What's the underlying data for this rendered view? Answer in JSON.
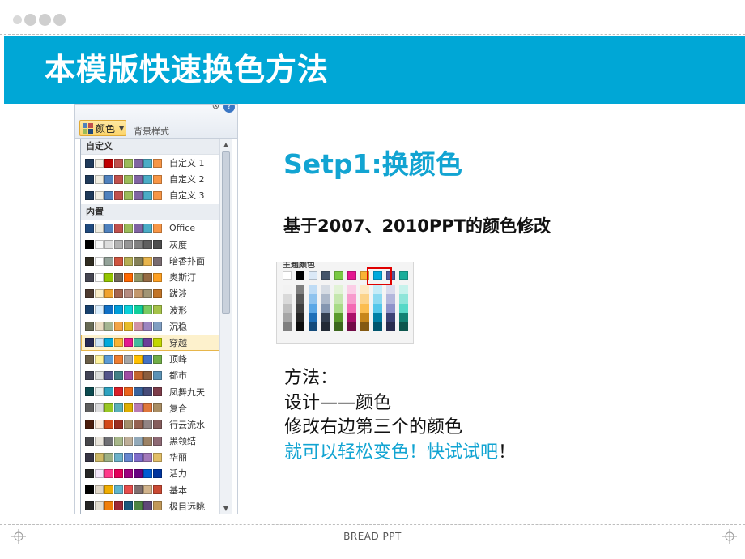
{
  "title": "本模版快速换色方法",
  "footer": "BREAD PPT",
  "step_title": "Setp1:换颜色",
  "subtitle": "基于2007、2010PPT的颜色修改",
  "method": {
    "line1": "方法：",
    "line2": "设计——颜色",
    "line3": "修改右边第三个的颜色",
    "line4": "就可以轻松变色！快试试吧",
    "line4_end": "！"
  },
  "picker": {
    "colors_button_label": "颜色",
    "background_style_label": "背景样式",
    "custom_header": "自定义",
    "builtin_header": "内置",
    "custom_themes": [
      {
        "name": "自定义 1",
        "colors": [
          "#1f3a5a",
          "#f2efe3",
          "#c00000",
          "#c0504d",
          "#9bbb59",
          "#8064a2",
          "#4bacc6",
          "#f79646"
        ]
      },
      {
        "name": "自定义 2",
        "colors": [
          "#1f3a5a",
          "#f2efe3",
          "#4f81bd",
          "#c0504d",
          "#9bbb59",
          "#8064a2",
          "#4bacc6",
          "#f79646"
        ]
      },
      {
        "name": "自定义 3",
        "colors": [
          "#1f3a5a",
          "#f2efe3",
          "#4f81bd",
          "#c0504d",
          "#9bbb59",
          "#8064a2",
          "#4bacc6",
          "#f79646"
        ]
      }
    ],
    "builtin_themes": [
      {
        "name": "Office",
        "colors": [
          "#1f497d",
          "#eeece1",
          "#4f81bd",
          "#c0504d",
          "#9bbb59",
          "#8064a2",
          "#4bacc6",
          "#f79646"
        ]
      },
      {
        "name": "灰度",
        "colors": [
          "#000000",
          "#f8f8f8",
          "#dddddd",
          "#b2b2b2",
          "#969696",
          "#808080",
          "#5f5f5f",
          "#4d4d4d"
        ]
      },
      {
        "name": "暗香扑面",
        "colors": [
          "#2f2b20",
          "#ffffff",
          "#93a299",
          "#cf543f",
          "#b5ae53",
          "#848058",
          "#e8b54d",
          "#786c71"
        ]
      },
      {
        "name": "奥斯汀",
        "colors": [
          "#454551",
          "#ffffff",
          "#94c600",
          "#71685a",
          "#ff6700",
          "#909465",
          "#956b43",
          "#fea022"
        ]
      },
      {
        "name": "跋涉",
        "colors": [
          "#4e3b30",
          "#fbeec9",
          "#f0a22e",
          "#a5644e",
          "#b58b80",
          "#c3986d",
          "#a19574",
          "#c17529"
        ]
      },
      {
        "name": "波形",
        "colors": [
          "#17406d",
          "#dbefff",
          "#0f6fc6",
          "#009dd9",
          "#0bd0d9",
          "#10cf9b",
          "#7cca62",
          "#a5c249"
        ]
      },
      {
        "name": "沉稳",
        "colors": [
          "#676a55",
          "#ebddc3",
          "#a5b592",
          "#f3a447",
          "#e7bc29",
          "#d092a7",
          "#9c85c0",
          "#809ec2"
        ]
      },
      {
        "name": "穿越",
        "colors": [
          "#242852",
          "#cfe5f7",
          "#00a9dc",
          "#f9b233",
          "#e4178f",
          "#45bb9d",
          "#6c3f99",
          "#c2d600"
        ]
      },
      {
        "name": "顶峰",
        "colors": [
          "#695d46",
          "#fff39d",
          "#5b9bd5",
          "#ed7d31",
          "#a5a5a5",
          "#ffc000",
          "#4472c4",
          "#70ad47"
        ]
      },
      {
        "name": "都市",
        "colors": [
          "#424456",
          "#dedfde",
          "#53548a",
          "#438086",
          "#a04da3",
          "#c4652d",
          "#8b5d3d",
          "#5c92b5"
        ]
      },
      {
        "name": "凤舞九天",
        "colors": [
          "#0c4b50",
          "#e8f0ee",
          "#2da2bf",
          "#da1f28",
          "#eb641b",
          "#39639d",
          "#474b78",
          "#7d3c4a"
        ]
      },
      {
        "name": "复合",
        "colors": [
          "#5e5e5e",
          "#ddddde",
          "#98c723",
          "#59b0b9",
          "#deae00",
          "#b77bb4",
          "#e0773c",
          "#a98d63"
        ]
      },
      {
        "name": "行云流水",
        "colors": [
          "#4b1e0e",
          "#fbeadb",
          "#d34817",
          "#9b2d1f",
          "#a28e6a",
          "#956251",
          "#918485",
          "#855d5d"
        ]
      },
      {
        "name": "黑领结",
        "colors": [
          "#46464a",
          "#e9e5dc",
          "#6f6f74",
          "#a7b789",
          "#beae98",
          "#92a9b9",
          "#9c8265",
          "#8d6974"
        ]
      },
      {
        "name": "华丽",
        "colors": [
          "#373545",
          "#ceb966",
          "#9cb084",
          "#6bb1c9",
          "#6585cf",
          "#7e6bc9",
          "#a379bb",
          "#e2be67"
        ]
      },
      {
        "name": "活力",
        "colors": [
          "#262626",
          "#f6e8fc",
          "#ff388c",
          "#e40059",
          "#9c007f",
          "#68007f",
          "#005bd3",
          "#00349e"
        ]
      },
      {
        "name": "基本",
        "colors": [
          "#000000",
          "#e0d7c7",
          "#f0ad00",
          "#60b5cc",
          "#e64d4c",
          "#7f6f6f",
          "#d2b48c",
          "#c94933"
        ]
      },
      {
        "name": "极目远眺",
        "colors": [
          "#262626",
          "#e3ded1",
          "#f07f09",
          "#9f2936",
          "#1b587c",
          "#4e8542",
          "#604878",
          "#c19859"
        ]
      }
    ],
    "selected_theme": "穿越"
  },
  "theme_colors": {
    "label": "主题颜色",
    "top_row": [
      "#ffffff",
      "#000000",
      "#dbe9f7",
      "#44546a",
      "#7ac943",
      "#e4178f",
      "#f9b233",
      "#00a9dc",
      "#525a9c",
      "#1aad9a"
    ],
    "shade_columns": [
      [
        "#f2f2f2",
        "#d9d9d9",
        "#bfbfbf",
        "#a6a6a6",
        "#7f7f7f"
      ],
      [
        "#7f7f7f",
        "#595959",
        "#404040",
        "#262626",
        "#0d0d0d"
      ],
      [
        "#bfdcf5",
        "#8fc3ee",
        "#5aa7e6",
        "#1d6fb8",
        "#134a7a"
      ],
      [
        "#d6dce4",
        "#adb9ca",
        "#8496b0",
        "#333f50",
        "#222a35"
      ],
      [
        "#e2f3d6",
        "#c5e7ae",
        "#a8db86",
        "#5a9a2c",
        "#3c671d"
      ],
      [
        "#fbcde6",
        "#f79bcd",
        "#f36ab4",
        "#ab106b",
        "#720b47"
      ],
      [
        "#fde9c4",
        "#fcd38a",
        "#fbbd50",
        "#c7861b",
        "#845912"
      ],
      [
        "#c6ecf8",
        "#8ddaf1",
        "#54c7ea",
        "#007fa5",
        "#00556e"
      ],
      [
        "#d9dbed",
        "#b3b7dc",
        "#8e93ca",
        "#3d4375",
        "#292d4e"
      ],
      [
        "#c7f2ec",
        "#8fe5d9",
        "#57d8c7",
        "#138274",
        "#0d564d"
      ]
    ]
  },
  "colors": {
    "accent": "#00a7d6",
    "highlight_text": "#12a4d2",
    "highlight_box": "#e00000"
  },
  "icons": [
    "help-icon",
    "collapse-icon",
    "scroll-up-icon",
    "scroll-down-icon",
    "crosshair-icon",
    "dot-icon"
  ]
}
